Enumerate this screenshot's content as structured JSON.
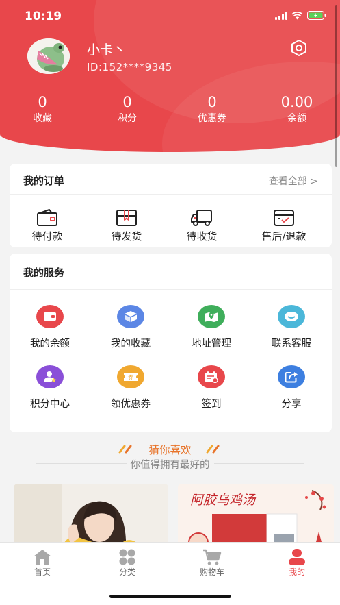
{
  "status_bar": {
    "time": "10:19"
  },
  "profile": {
    "name": "小卡丶",
    "id_text": "ID:152****9345"
  },
  "stats": [
    {
      "value": "0",
      "label": "收藏"
    },
    {
      "value": "0",
      "label": "积分"
    },
    {
      "value": "0",
      "label": "优惠券"
    },
    {
      "value": "0.00",
      "label": "余额"
    }
  ],
  "orders": {
    "title": "我的订单",
    "view_all": "查看全部 >",
    "items": [
      {
        "label": "待付款",
        "icon": "wallet-icon"
      },
      {
        "label": "待发货",
        "icon": "package-icon"
      },
      {
        "label": "待收货",
        "icon": "truck-icon"
      },
      {
        "label": "售后/退款",
        "icon": "refund-box-icon"
      }
    ]
  },
  "services": {
    "title": "我的服务",
    "items": [
      {
        "label": "我的余额",
        "icon": "wallet-icon",
        "color": "#e8474b"
      },
      {
        "label": "我的收藏",
        "icon": "box-icon",
        "color": "#5b86e5"
      },
      {
        "label": "地址管理",
        "icon": "map-icon",
        "color": "#3fae5b"
      },
      {
        "label": "联系客服",
        "icon": "chat-icon",
        "color": "#4bb7d9"
      },
      {
        "label": "积分中心",
        "icon": "user-star-icon",
        "color": "#8a4fd8"
      },
      {
        "label": "领优惠券",
        "icon": "coupon-icon",
        "color": "#f0a830"
      },
      {
        "label": "签到",
        "icon": "calendar-icon",
        "color": "#e8474b"
      },
      {
        "label": "分享",
        "icon": "share-icon",
        "color": "#3d7fe0"
      }
    ]
  },
  "guess": {
    "title": "猜你喜欢",
    "subtitle": "你值得拥有最好的"
  },
  "products": [
    {
      "image": "woman-in-yellow-cardigan"
    },
    {
      "image": "donkey-hide-gelatin-chicken-soup",
      "caption": "阿胶乌鸡汤"
    }
  ],
  "tabbar": {
    "items": [
      {
        "label": "首页",
        "icon": "home-icon"
      },
      {
        "label": "分类",
        "icon": "category-icon"
      },
      {
        "label": "购物车",
        "icon": "cart-icon"
      },
      {
        "label": "我的",
        "icon": "profile-icon",
        "active": true
      }
    ]
  },
  "colors": {
    "brand": "#e8474b",
    "accent_orange": "#e8742a"
  }
}
